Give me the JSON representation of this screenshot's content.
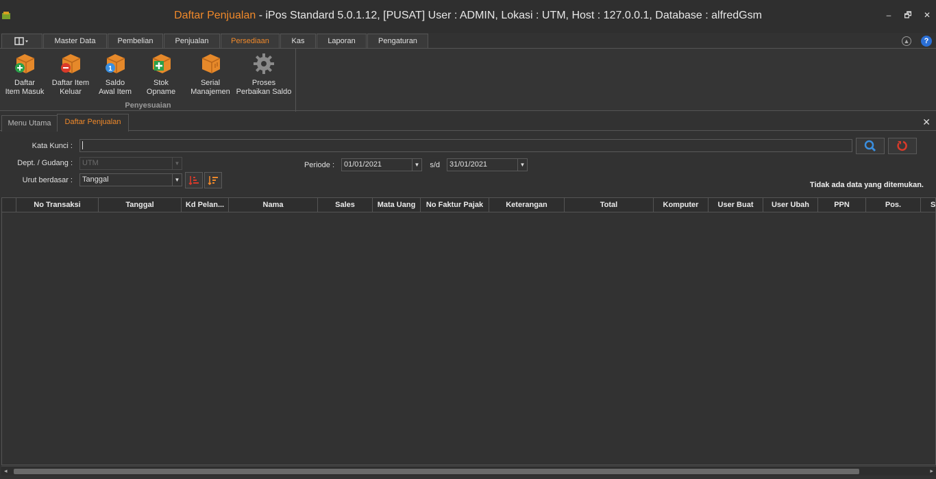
{
  "title": {
    "part1": "Daftar Penjualan",
    "part2": " - iPos Standard 5.0.1.12, [PUSAT] User : ADMIN, Lokasi : UTM, Host : 127.0.0.1, Database : alfredGsm"
  },
  "window_controls": {
    "minimize": "–",
    "restore": "🗗",
    "close": "✕"
  },
  "ribbon_tabs": [
    "Master Data",
    "Pembelian",
    "Penjualan",
    "Persediaan",
    "Kas",
    "Laporan",
    "Pengaturan"
  ],
  "ribbon_active_tab": "Persediaan",
  "help_label": "?",
  "ribbon_buttons": [
    {
      "label1": "Daftar",
      "label2": "Item Masuk",
      "icon": "box-add-icon"
    },
    {
      "label1": "Daftar Item",
      "label2": "Keluar",
      "icon": "box-remove-icon"
    },
    {
      "label1": "Saldo",
      "label2": "Awal Item",
      "icon": "box-number-icon"
    },
    {
      "label1": "Stok Opname",
      "label2": "",
      "icon": "box-plus-icon"
    },
    {
      "label1": "Serial",
      "label2": "Manajemen",
      "icon": "box-icon"
    },
    {
      "label1": "Proses",
      "label2": "Perbaikan Saldo",
      "icon": "gear-icon"
    }
  ],
  "ribbon_group_label": "Penyesuaian",
  "doc_tabs": [
    "Menu Utama",
    "Daftar Penjualan"
  ],
  "doc_active_tab": "Daftar Penjualan",
  "filters": {
    "kata_kunci_label": "Kata Kunci :",
    "kata_kunci_value": "",
    "dept_label": "Dept. / Gudang :",
    "dept_value": "UTM",
    "urut_label": "Urut berdasar :",
    "urut_value": "Tanggal",
    "periode_label": "Periode :",
    "periode_from": "01/01/2021",
    "sd_label": "s/d",
    "periode_to": "31/01/2021"
  },
  "status_text": "Tidak ada data yang ditemukan.",
  "columns": [
    "No Transaksi",
    "Tanggal",
    "Kd Pelan...",
    "Nama",
    "Sales",
    "Mata Uang",
    "No Faktur Pajak",
    "Keterangan",
    "Total",
    "Komputer",
    "User Buat",
    "User Ubah",
    "PPN",
    "Pos.",
    "S"
  ],
  "colors": {
    "accent": "#f0892a",
    "background": "#323232",
    "help": "#2a6fd6",
    "search": "#3a8fe0",
    "reset": "#d93a2a"
  }
}
